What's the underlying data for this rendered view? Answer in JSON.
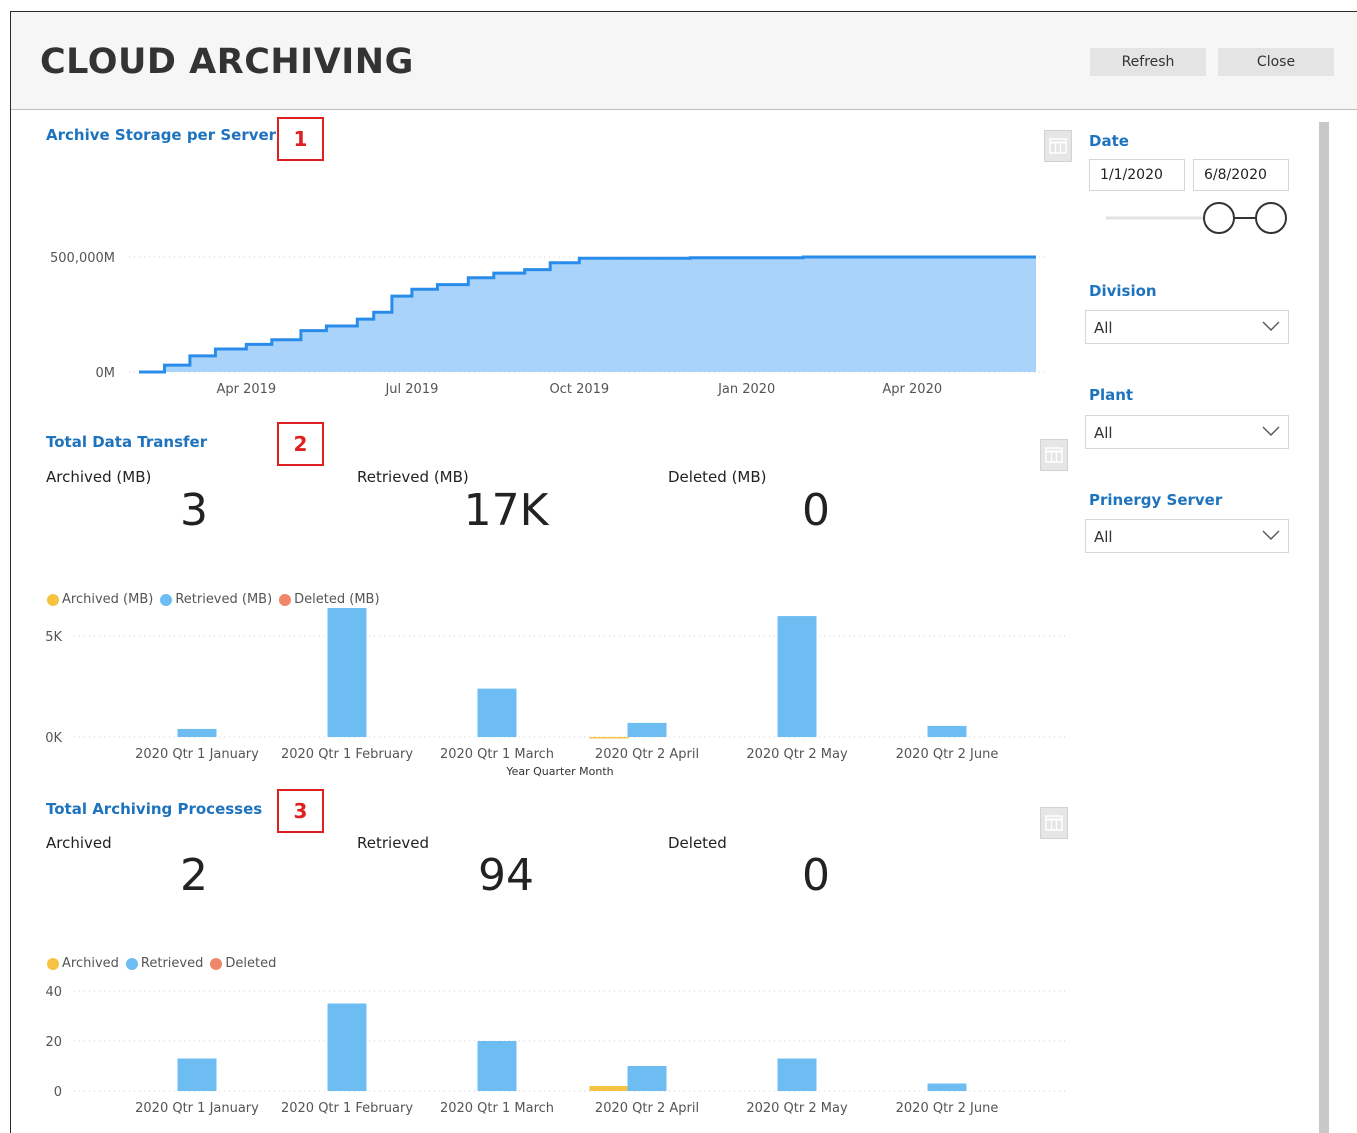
{
  "header": {
    "title": "CLOUD ARCHIVING",
    "refresh_label": "Refresh",
    "close_label": "Close"
  },
  "sections": {
    "storage": {
      "title": "Archive Storage per Server",
      "marker": "1"
    },
    "transfer": {
      "title": "Total Data Transfer",
      "marker": "2"
    },
    "processes": {
      "title": "Total Archiving Processes",
      "marker": "3"
    }
  },
  "kpis": {
    "transfer": [
      {
        "label": "Archived (MB)",
        "value": "3"
      },
      {
        "label": "Retrieved (MB)",
        "value": "17K"
      },
      {
        "label": "Deleted (MB)",
        "value": "0"
      }
    ],
    "processes": [
      {
        "label": "Archived",
        "value": "2"
      },
      {
        "label": "Retrieved",
        "value": "94"
      },
      {
        "label": "Deleted",
        "value": "0"
      }
    ]
  },
  "filters": {
    "date": {
      "label": "Date",
      "start": "1/1/2020",
      "end": "6/8/2020"
    },
    "division": {
      "label": "Division",
      "value": "All"
    },
    "plant": {
      "label": "Plant",
      "value": "All"
    },
    "server": {
      "label": "Prinergy Server",
      "value": "All"
    }
  },
  "colors": {
    "archived": "#f5c242",
    "retrieved": "#6dbdf2",
    "deleted": "#f0866a",
    "area_fill": "#a9d3fa",
    "area_line": "#2a8cea",
    "title_blue": "#1e73be"
  },
  "chart_data": [
    {
      "type": "area",
      "title": "Archive Storage per Server",
      "y_ticks": [
        "500,000M",
        "0M"
      ],
      "y_tick_values": [
        500000,
        0
      ],
      "ylim": [
        0,
        500000
      ],
      "x_ticks": [
        "Apr 2019",
        "Jul 2019",
        "Oct 2019",
        "Jan 2020",
        "Apr 2020"
      ],
      "x": [
        "2019-02-01",
        "2019-02-15",
        "2019-03-01",
        "2019-03-15",
        "2019-04-01",
        "2019-04-15",
        "2019-05-01",
        "2019-05-15",
        "2019-06-01",
        "2019-06-10",
        "2019-06-20",
        "2019-07-01",
        "2019-07-15",
        "2019-08-01",
        "2019-08-15",
        "2019-09-01",
        "2019-09-15",
        "2019-10-01",
        "2019-12-01",
        "2020-02-01",
        "2020-04-01",
        "2020-06-08"
      ],
      "values": [
        0,
        30000,
        70000,
        100000,
        120000,
        140000,
        180000,
        200000,
        230000,
        260000,
        330000,
        360000,
        380000,
        410000,
        430000,
        445000,
        475000,
        495000,
        497000,
        500000,
        500000,
        500000
      ],
      "grid": true
    },
    {
      "type": "bar",
      "legend": [
        "Archived (MB)",
        "Retrieved (MB)",
        "Deleted (MB)"
      ],
      "legend_position": "top-left",
      "xlabel": "Year Quarter Month",
      "y_ticks": [
        "5K",
        "0K"
      ],
      "y_tick_values": [
        5000,
        0
      ],
      "ylim": [
        0,
        6500
      ],
      "categories": [
        "2020 Qtr 1 January",
        "2020 Qtr 1 February",
        "2020 Qtr 1 March",
        "2020 Qtr 2 April",
        "2020 Qtr 2 May",
        "2020 Qtr 2 June"
      ],
      "series": [
        {
          "name": "Archived (MB)",
          "values": [
            0,
            0,
            0,
            3,
            0,
            0
          ]
        },
        {
          "name": "Retrieved (MB)",
          "values": [
            400,
            6400,
            2400,
            700,
            6000,
            550
          ]
        },
        {
          "name": "Deleted (MB)",
          "values": [
            0,
            0,
            0,
            0,
            0,
            0
          ]
        }
      ],
      "grid": true
    },
    {
      "type": "bar",
      "legend": [
        "Archived",
        "Retrieved",
        "Deleted"
      ],
      "legend_position": "top-left",
      "xlabel": "",
      "y_ticks": [
        "40",
        "20",
        "0"
      ],
      "y_tick_values": [
        40,
        20,
        0
      ],
      "ylim": [
        0,
        40
      ],
      "categories": [
        "2020 Qtr 1 January",
        "2020 Qtr 1 February",
        "2020 Qtr 1 March",
        "2020 Qtr 2 April",
        "2020 Qtr 2 May",
        "2020 Qtr 2 June"
      ],
      "series": [
        {
          "name": "Archived",
          "values": [
            0,
            0,
            0,
            2,
            0,
            0
          ]
        },
        {
          "name": "Retrieved",
          "values": [
            13,
            35,
            20,
            10,
            13,
            3
          ]
        },
        {
          "name": "Deleted",
          "values": [
            0,
            0,
            0,
            0,
            0,
            0
          ]
        }
      ],
      "grid": true
    }
  ]
}
